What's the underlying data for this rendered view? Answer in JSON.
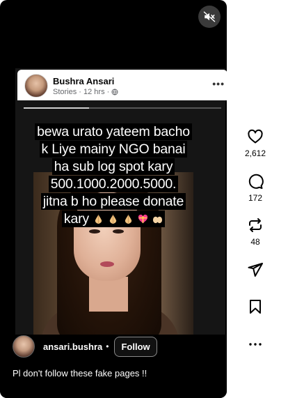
{
  "story": {
    "author": "Bushra Ansari",
    "meta": "Stories · 12 hrs ·",
    "progress_fraction": 0.33,
    "overlay_lines": [
      "bewa urato yateem bacho",
      "k Liye mainy NGO banai",
      "ha sub log spot kary",
      "500.1000.2000.5000.",
      "jitna b ho please donate",
      "kary"
    ]
  },
  "post": {
    "username": "ansari.bushra",
    "dot": "•",
    "follow_label": "Follow",
    "caption": "Pl don't follow these fake pages !!"
  },
  "actions": {
    "likes": "2,612",
    "comments": "172",
    "reposts": "48"
  },
  "icons": [
    "mute-icon",
    "heart-icon",
    "comment-icon",
    "repost-icon",
    "share-icon",
    "bookmark-icon",
    "more-icon",
    "globe-icon",
    "folded-hands-icon",
    "heart-gift-icon",
    "open-hands-icon"
  ]
}
